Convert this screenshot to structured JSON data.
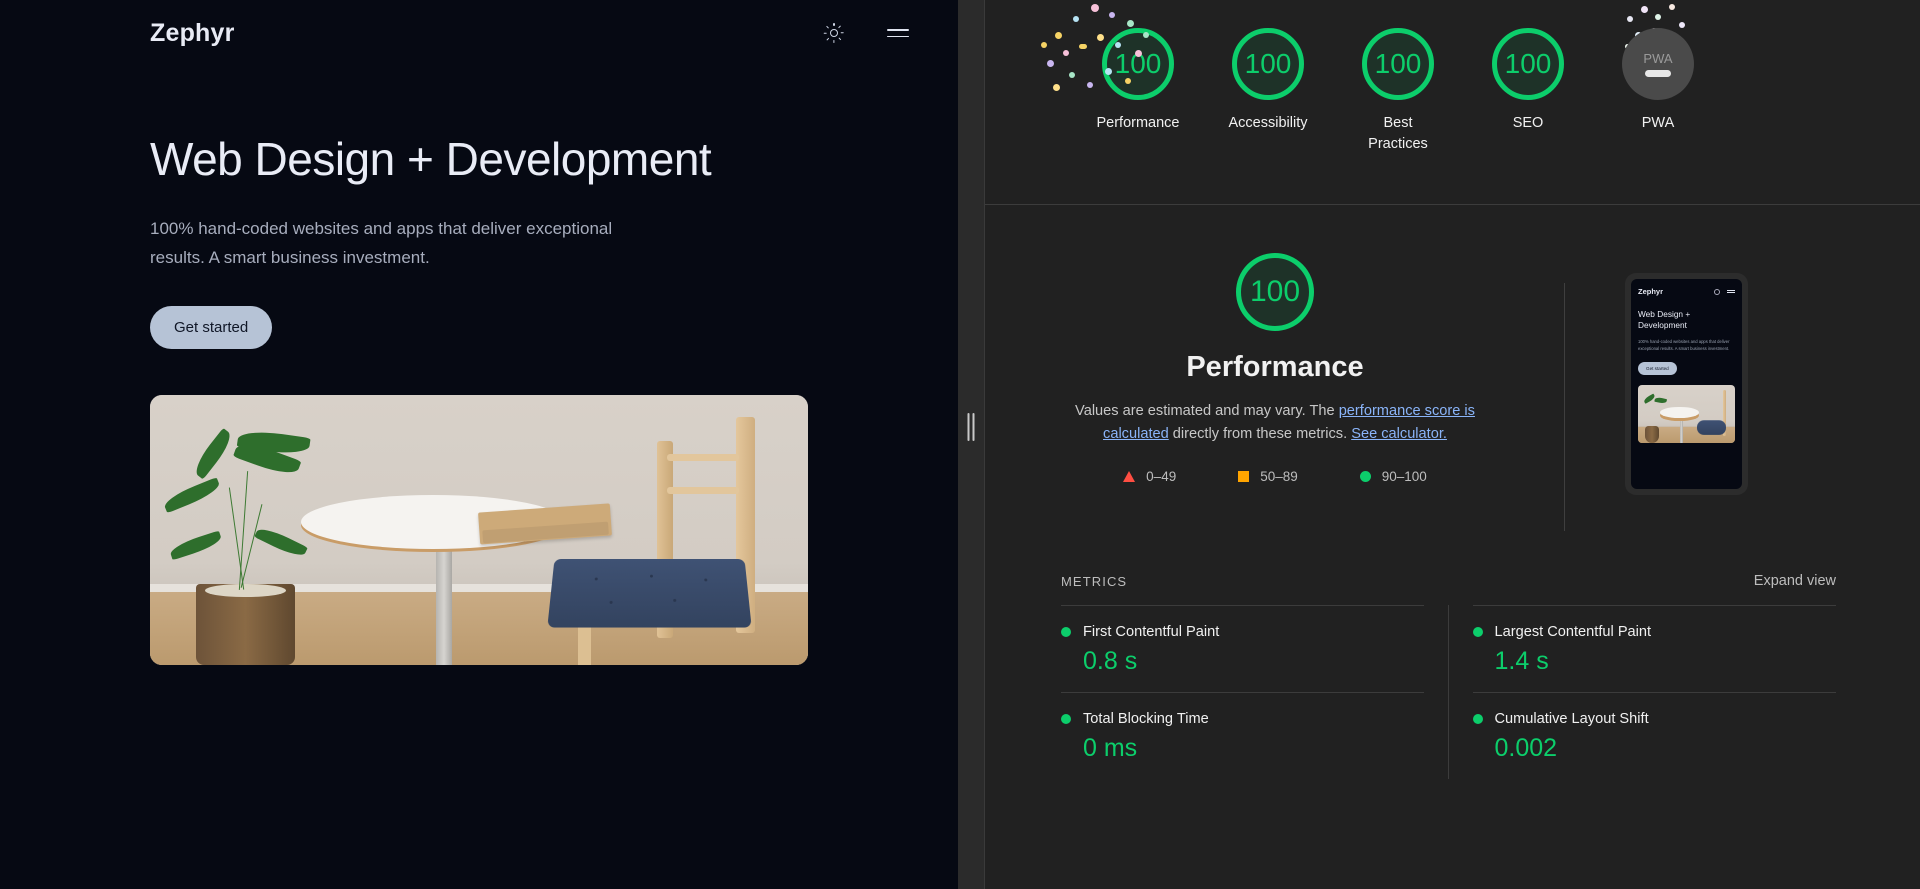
{
  "site": {
    "brand": "Zephyr",
    "theme_toggle_icon": "sun-icon",
    "menu_icon": "hamburger-menu-icon",
    "heading": "Web Design + Development",
    "subheading": "100% hand-coded websites and apps that deliver exceptional results. A smart business investment.",
    "cta_label": "Get started",
    "photo_alt": "round white table with notebook, potted plant and wooden chair with navy cushion"
  },
  "lighthouse": {
    "gauges": [
      {
        "score": "100",
        "label": "Performance",
        "status": "pass",
        "confetti": true
      },
      {
        "score": "100",
        "label": "Accessibility",
        "status": "pass",
        "confetti": false
      },
      {
        "score": "100",
        "label": "Best Practices",
        "status": "pass",
        "confetti": false
      },
      {
        "score": "100",
        "label": "SEO",
        "status": "pass",
        "confetti": false
      },
      {
        "score": "PWA",
        "label": "PWA",
        "status": "na",
        "confetti": true
      }
    ],
    "detail": {
      "score": "100",
      "title": "Performance",
      "desc_part1": "Values are estimated and may vary. The ",
      "link1": "performance score is calculated",
      "desc_part2": " directly from these metrics. ",
      "link2": "See calculator.",
      "legend": [
        {
          "shape": "triangle",
          "color": "#ff4e42",
          "range": "0–49"
        },
        {
          "shape": "square",
          "color": "#ffa400",
          "range": "50–89"
        },
        {
          "shape": "circle",
          "color": "#0cce6b",
          "range": "90–100"
        }
      ]
    },
    "metrics": {
      "title": "METRICS",
      "expand_label": "Expand view",
      "left": [
        {
          "name": "First Contentful Paint",
          "value": "0.8 s",
          "status": "pass"
        },
        {
          "name": "Total Blocking Time",
          "value": "0 ms",
          "status": "pass"
        }
      ],
      "right": [
        {
          "name": "Largest Contentful Paint",
          "value": "1.4 s",
          "status": "pass"
        },
        {
          "name": "Cumulative Layout Shift",
          "value": "0.002",
          "status": "pass"
        }
      ]
    }
  },
  "colors": {
    "pass_green": "#0cce6b",
    "average_orange": "#ffa400",
    "fail_red": "#ff4e42",
    "link_blue": "#8ab4f8",
    "panel_bg": "#212121",
    "site_bg": "#060913"
  }
}
